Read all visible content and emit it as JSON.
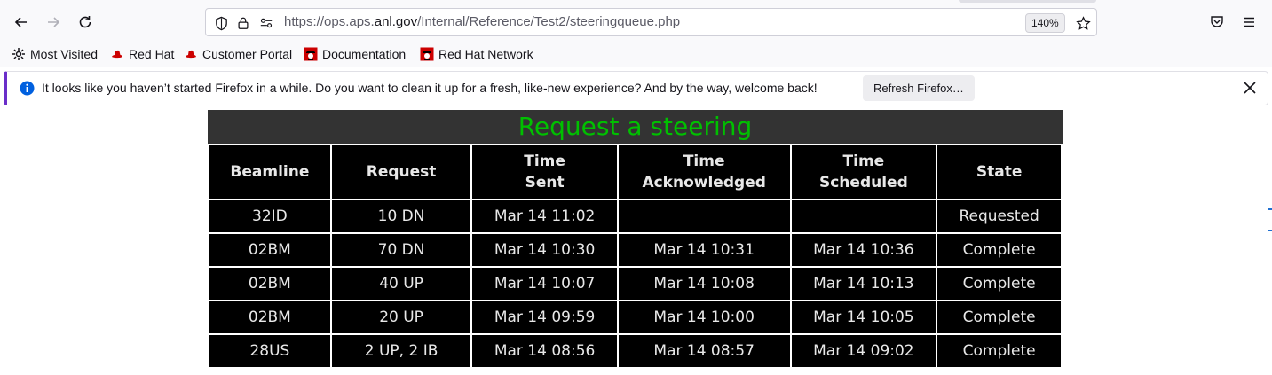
{
  "browser": {
    "url_prefix": "https://ops.aps.",
    "url_host": "anl.gov",
    "url_path": "/Internal/Reference/Test2/steeringqueue.php",
    "zoom": "140%"
  },
  "bookmarks": [
    {
      "label": "Most Visited",
      "icon": "gear-icon"
    },
    {
      "label": "Red Hat",
      "icon": "redhat-icon"
    },
    {
      "label": "Customer Portal",
      "icon": "redhat-icon"
    },
    {
      "label": "Documentation",
      "icon": "redhat-shadowman-icon"
    },
    {
      "label": "Red Hat Network",
      "icon": "redhat-shadowman-icon"
    }
  ],
  "notification": {
    "message": "It looks like you haven’t started Firefox in a while. Do you want to clean it up for a fresh, like-new experience? And by the way, welcome back!",
    "button_label": "Refresh Firefox…"
  },
  "page": {
    "title": "Request a steering",
    "title_color": "#00c000",
    "headers": [
      [
        "Beamline"
      ],
      [
        "Request"
      ],
      [
        "Time",
        "Sent"
      ],
      [
        "Time",
        "Acknowledged"
      ],
      [
        "Time",
        "Scheduled"
      ],
      [
        "State"
      ]
    ],
    "rows": [
      [
        "32ID",
        "10 DN",
        "Mar 14 11:02",
        "",
        "",
        "Requested"
      ],
      [
        "02BM",
        "70 DN",
        "Mar 14 10:30",
        "Mar 14 10:31",
        "Mar 14 10:36",
        "Complete"
      ],
      [
        "02BM",
        "40 UP",
        "Mar 14 10:07",
        "Mar 14 10:08",
        "Mar 14 10:13",
        "Complete"
      ],
      [
        "02BM",
        "20 UP",
        "Mar 14 09:59",
        "Mar 14 10:00",
        "Mar 14 10:05",
        "Complete"
      ],
      [
        "28US",
        "2 UP, 2 IB",
        "Mar 14 08:56",
        "Mar 14 08:57",
        "Mar 14 09:02",
        "Complete"
      ]
    ]
  }
}
